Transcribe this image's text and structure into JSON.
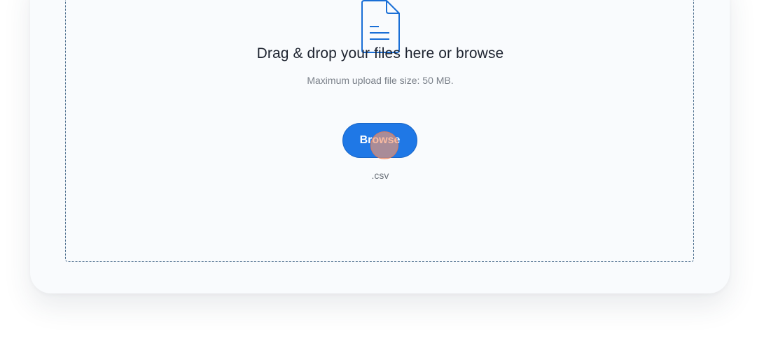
{
  "upload": {
    "headline": "Drag & drop your files here or browse",
    "max_size_text": "Maximum upload file size: 50 MB.",
    "browse_label": "Browse",
    "accepted_types": ".csv"
  },
  "icons": {
    "file": "document-icon"
  },
  "colors": {
    "accent": "#1f78e6",
    "icon_stroke": "#1a6fd6",
    "card_bg": "#f9fbfd",
    "dropzone_border": "#4a6c8c",
    "click_marker": "#f5966e"
  }
}
